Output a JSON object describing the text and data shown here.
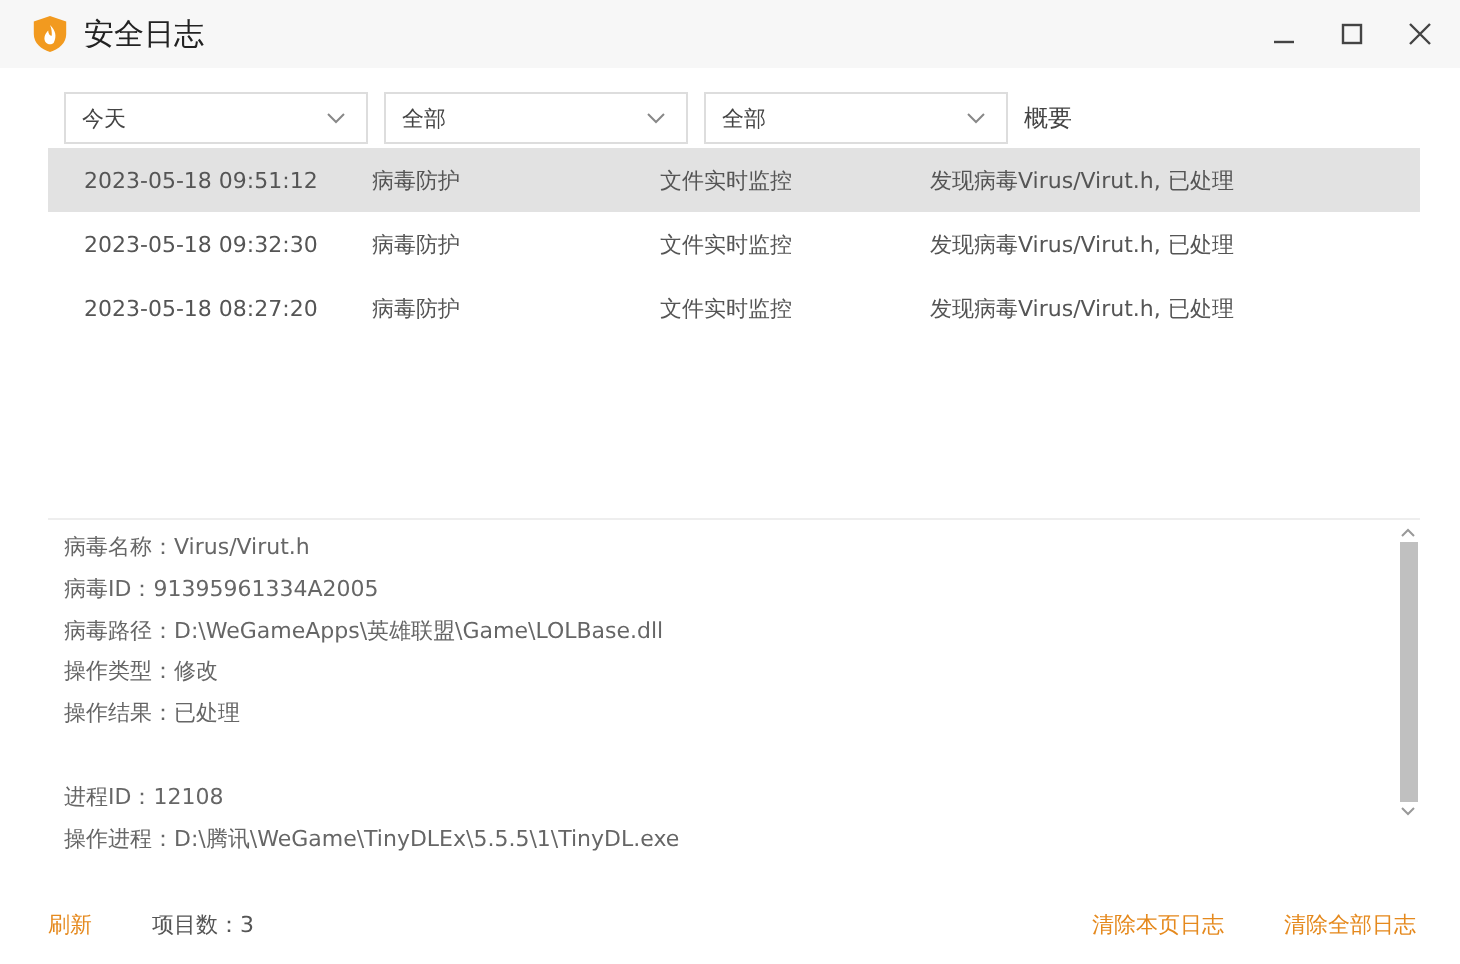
{
  "window": {
    "title": "安全日志"
  },
  "filters": [
    {
      "value": "今天"
    },
    {
      "value": "全部"
    },
    {
      "value": "全部"
    }
  ],
  "table": {
    "columns": [
      "概要"
    ],
    "rows": [
      {
        "time": "2023-05-18 09:51:12",
        "category": "病毒防护",
        "source": "文件实时监控",
        "summary": "发现病毒Virus/Virut.h, 已处理",
        "selected": true
      },
      {
        "time": "2023-05-18 09:32:30",
        "category": "病毒防护",
        "source": "文件实时监控",
        "summary": "发现病毒Virus/Virut.h, 已处理",
        "selected": false
      },
      {
        "time": "2023-05-18 08:27:20",
        "category": "病毒防护",
        "source": "文件实时监控",
        "summary": "发现病毒Virus/Virut.h, 已处理",
        "selected": false
      }
    ]
  },
  "details": [
    [
      "病毒名称：Virus/Virut.h",
      "病毒ID：91395961334A2005",
      "病毒路径：D:\\WeGameApps\\英雄联盟\\Game\\LOLBase.dll",
      "操作类型：修改",
      "操作结果：已处理"
    ],
    [
      "进程ID：12108",
      "操作进程：D:\\腾讯\\WeGame\\TinyDLEx\\5.5.5\\1\\TinyDL.exe"
    ]
  ],
  "status_bar": {
    "refresh": "刷新",
    "count": "项目数：3",
    "actions": [
      "清除本页日志",
      "清除全部日志"
    ]
  }
}
